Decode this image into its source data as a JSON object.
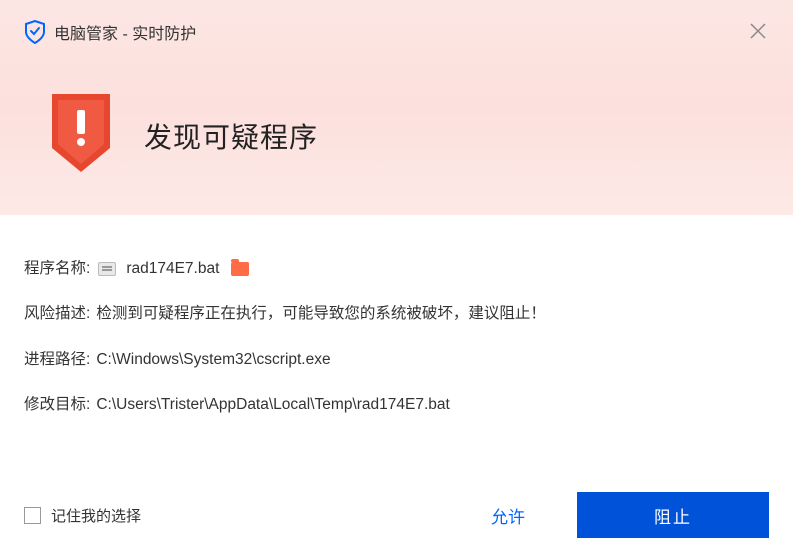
{
  "window": {
    "title": "电脑管家 - 实时防护"
  },
  "alert": {
    "heading": "发现可疑程序"
  },
  "details": {
    "program_name_label": "程序名称:",
    "program_name_value": "rad174E7.bat",
    "risk_label": "风险描述:",
    "risk_value": "检测到可疑程序正在执行，可能导致您的系统被破坏，建议阻止！",
    "process_path_label": "进程路径:",
    "process_path_value": "C:\\Windows\\System32\\cscript.exe",
    "target_label": "修改目标:",
    "target_value": "C:\\Users\\Trister\\AppData\\Local\\Temp\\rad174E7.bat"
  },
  "footer": {
    "remember_label": "记住我的选择",
    "allow_label": "允许",
    "block_label": "阻止"
  }
}
